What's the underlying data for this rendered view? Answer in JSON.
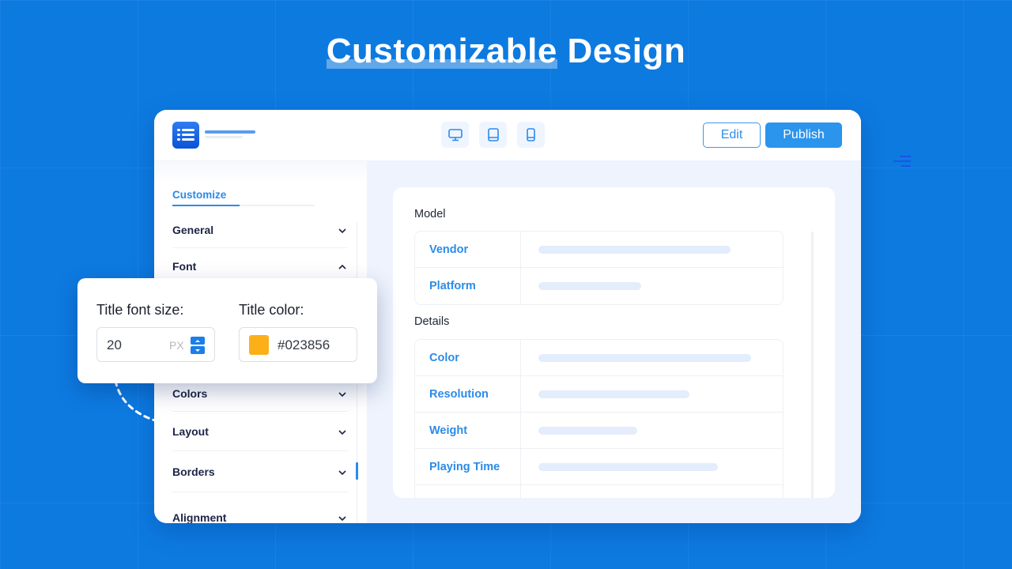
{
  "hero": {
    "title_highlight": "Customizable",
    "title_rest": " Design"
  },
  "colors": {
    "background": "#0d7ae0",
    "accent": "#2b8aea",
    "publish_button": "#2b94ec",
    "swatch": "#fbb01a",
    "label_dark": "#1c2447"
  },
  "toolbar": {
    "logo_icon": "list-icon",
    "device_buttons": [
      {
        "name": "desktop",
        "icon": "desktop-icon"
      },
      {
        "name": "tablet",
        "icon": "tablet-icon"
      },
      {
        "name": "mobile",
        "icon": "mobile-icon"
      }
    ],
    "edit_label": "Edit",
    "publish_label": "Publish"
  },
  "sidebar": {
    "tab_label": "Customize",
    "items": [
      {
        "label": "General",
        "state": "collapsed"
      },
      {
        "label": "Font",
        "state": "expanded"
      },
      {
        "label": "Colors",
        "state": "collapsed"
      },
      {
        "label": "Layout",
        "state": "collapsed"
      },
      {
        "label": "Borders",
        "state": "collapsed"
      },
      {
        "label": "Alignment",
        "state": "collapsed"
      }
    ]
  },
  "popover": {
    "font_size_label": "Title font size:",
    "font_size_value": "20",
    "font_size_unit": "PX",
    "color_label": "Title color:",
    "color_value": "#023856"
  },
  "content": {
    "sections": [
      {
        "title": "Model",
        "rows": [
          {
            "key": "Vendor"
          },
          {
            "key": "Platform"
          }
        ]
      },
      {
        "title": "Details",
        "rows": [
          {
            "key": "Color"
          },
          {
            "key": "Resolution"
          },
          {
            "key": "Weight"
          },
          {
            "key": "Playing Time"
          },
          {
            "key": ""
          }
        ]
      }
    ]
  }
}
